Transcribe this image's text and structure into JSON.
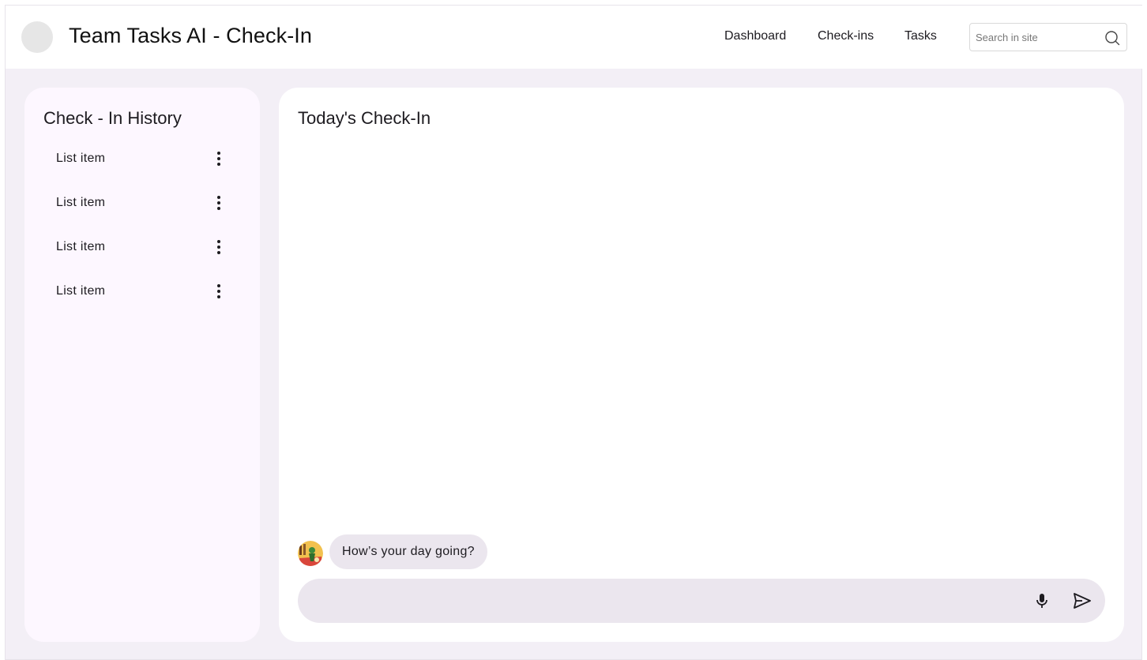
{
  "header": {
    "title": "Team Tasks AI - Check-In",
    "nav": {
      "dashboard": "Dashboard",
      "checkins": "Check-ins",
      "tasks": "Tasks"
    },
    "search": {
      "placeholder": "Search in site",
      "value": ""
    }
  },
  "sidebar": {
    "title": "Check - In History",
    "items": [
      {
        "label": "List item",
        "icon": "more-vert-icon"
      },
      {
        "label": "List item",
        "icon": "more-vert-icon"
      },
      {
        "label": "List item",
        "icon": "more-vert-icon"
      },
      {
        "label": "List item",
        "icon": "more-vert-icon"
      }
    ]
  },
  "main": {
    "title": "Today's Check-In",
    "messages": [
      {
        "text": "How’s your day going?"
      }
    ],
    "composer": {
      "value": "",
      "icons": [
        "mic-icon",
        "send-icon"
      ]
    }
  },
  "colors": {
    "page_background": "#f3eff6",
    "sidebar_background": "#fdf7ff",
    "bubble_background": "#ebe6ee",
    "composer_background": "#ebe6ee"
  }
}
